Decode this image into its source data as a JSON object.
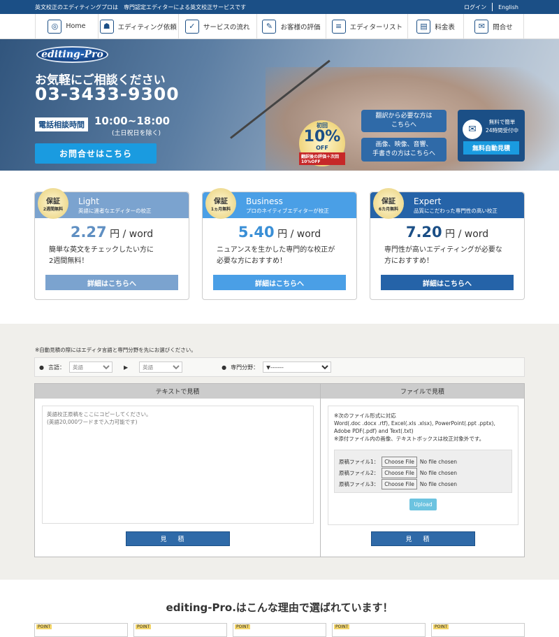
{
  "topbar": {
    "tagline": "英文校正のエディティングプロは　専門認定エディターによる英文校正サービスです",
    "login": "ログイン",
    "english": "English"
  },
  "nav": {
    "items": [
      {
        "label": "Home",
        "icon": "globe-icon"
      },
      {
        "label": "エディティング依頼",
        "icon": "people-icon"
      },
      {
        "label": "サービスの流れ",
        "icon": "checkbox-icon"
      },
      {
        "label": "お客様の評価",
        "icon": "edit-icon"
      },
      {
        "label": "エディターリスト",
        "icon": "list-icon"
      },
      {
        "label": "料金表",
        "icon": "document-icon"
      },
      {
        "label": "問合せ",
        "icon": "mail-icon"
      }
    ]
  },
  "hero": {
    "logo": "editing-Pro",
    "headline": "お気軽にご相談ください",
    "phone": "03-3433-9300",
    "hours_label": "電話相談時間",
    "hours": "10:00~18:00",
    "hours_note": "(土日祝日を除く)",
    "contact_button": "お問合せはこちら",
    "badge_first": "初回",
    "badge_pct": "10%",
    "badge_off": "OFF",
    "badge_note": "翻訳後の評価＋次回10%OFF",
    "btn_translate": "翻訳から必要な方は\nこちらへ",
    "btn_media": "画像、映像、音響、\n手書きの方はこちらへ",
    "free_text": "無料で簡単\n24時間受付中",
    "free_button": "無料自動見積"
  },
  "plans": [
    {
      "seal_main": "保証",
      "seal_sub": "2週間無料",
      "name": "Light",
      "desc": "英語に連者なエディターの校正",
      "price": "2.27",
      "unit": "円 / word",
      "text": "簡単な英文をチェックしたい方に\n2週間無料！",
      "button": "詳細はこちらへ",
      "color": "#7ba3cf",
      "price_color": "#5f8fc2"
    },
    {
      "seal_main": "保証",
      "seal_sub": "1ヵ月無料",
      "name": "Business",
      "desc": "プロのネイティブエディターが校正",
      "price": "5.40",
      "unit": "円 / word",
      "text": "ニュアンスを生かした専門的な校正が\n必要な方におすすめ！",
      "button": "詳細はこちらへ",
      "color": "#4a9fe6",
      "price_color": "#3a8fd6"
    },
    {
      "seal_main": "保証",
      "seal_sub": "6カ月無料",
      "name": "Expert",
      "desc": "品質にこだわった専門性の高い校正",
      "price": "7.20",
      "unit": "円 / word",
      "text": "専門性が高いエディティングが必要な\n方におすすめ！",
      "button": "詳細はこちらへ",
      "color": "#2563a8",
      "price_color": "#1b4f86"
    }
  ],
  "quote": {
    "note": "※自動見積の際にはエディタ言語と専門分野を先にお選びください。",
    "lang_label": "言語：",
    "lang_from": "英語",
    "lang_to": "英語",
    "field_label": "専門分野：",
    "field_value": "▼-------",
    "text_title": "テキストで見積",
    "text_placeholder": "英語校正原稿をここにコピーしてください。\n(英語20,000ワードまで入力可能です)",
    "file_title": "ファイルで見積",
    "file_info": "※次のファイル形式に対応\nWord(.doc .docx .rtf), Excel(.xls .xlsx), PowerPoint(.ppt .pptx), Adobe PDF(.pdf) and Text(.txt)\n※添付ファイル内の画像、テキストボックスは校正対象外です。",
    "files": [
      {
        "label": "原稿ファイル1：",
        "button": "Choose File",
        "status": "No file chosen"
      },
      {
        "label": "原稿ファイル2：",
        "button": "Choose File",
        "status": "No file chosen"
      },
      {
        "label": "原稿ファイル3：",
        "button": "Choose File",
        "status": "No file chosen"
      }
    ],
    "upload": "Upload",
    "estimate": "見積"
  },
  "reasons": {
    "title": "editing-Pro.はこんな理由で選ばれています！",
    "point_label": "POINT"
  }
}
